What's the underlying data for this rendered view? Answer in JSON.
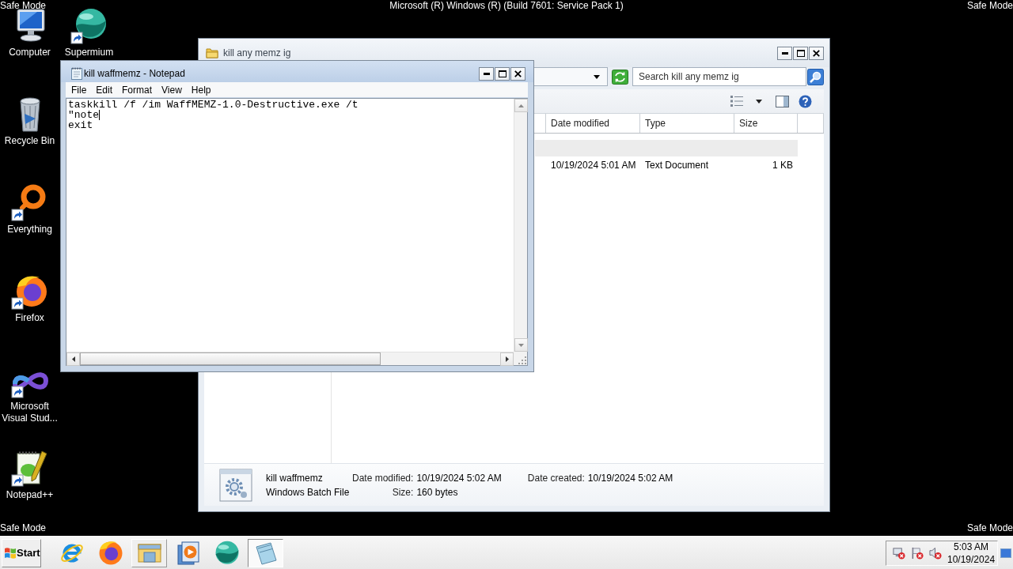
{
  "desktop": {
    "header": {
      "left": "Safe Mode",
      "center": "Microsoft (R) Windows (R) (Build 7601: Service Pack 1)",
      "right": "Safe Mode"
    },
    "icons": [
      {
        "label": "Computer",
        "kind": "computer",
        "shortcut": false
      },
      {
        "label": "Recycle Bin",
        "kind": "bin",
        "shortcut": false
      },
      {
        "label": "Everything",
        "kind": "ring",
        "shortcut": true
      },
      {
        "label": "Firefox",
        "kind": "fox",
        "shortcut": true
      },
      {
        "label": "Microsoft Visual Stud...",
        "kind": "infinity",
        "shortcut": true
      },
      {
        "label": "Notepad++",
        "kind": "notepad",
        "shortcut": true
      },
      {
        "label": "Supermium",
        "kind": "sphere",
        "shortcut": true
      }
    ],
    "footer": {
      "left": "Safe Mode",
      "right": "Safe Mode"
    }
  },
  "explorer": {
    "title": "kill any memz ig",
    "active": false,
    "search": {
      "placeholder": "Search kill any memz ig"
    },
    "columns": [
      {
        "label": "Date modified"
      },
      {
        "label": "Type"
      },
      {
        "label": "Size"
      }
    ],
    "rows": [
      {
        "selected": true
      },
      {
        "selected": false,
        "cells": [
          "10/19/2024 5:01 AM",
          "Text Document",
          "1 KB"
        ]
      }
    ],
    "details": {
      "name": "kill waffmemz",
      "file_type": "Windows Batch File",
      "field_groups": [
        {
          "fields": [
            {
              "label": "Date modified:",
              "value": "10/19/2024 5:02 AM"
            },
            {
              "label": "Size:",
              "value": "160 bytes"
            }
          ]
        },
        {
          "fields": [
            {
              "label": "Date created:",
              "value": "10/19/2024 5:02 AM"
            }
          ]
        }
      ]
    }
  },
  "notepad": {
    "title": "kill waffmemz - Notepad",
    "active": true,
    "menu": [
      "File",
      "Edit",
      "Format",
      "View",
      "Help"
    ],
    "lines": [
      {
        "text": "taskkill /f /im WaffMEMZ-1.0-Destructive.exe /t",
        "caret": false
      },
      {
        "text": "\"note",
        "caret": true
      },
      {
        "text": "exit",
        "caret": false
      }
    ]
  },
  "taskbar": {
    "start": {
      "label": "Start"
    },
    "buttons": [
      {
        "kind": "ie",
        "open": false,
        "selected": false
      },
      {
        "kind": "fox",
        "open": false,
        "selected": false
      },
      {
        "kind": "folder",
        "open": true,
        "selected": false
      },
      {
        "kind": "player",
        "open": false,
        "selected": false
      },
      {
        "kind": "sphere",
        "open": false,
        "selected": false
      },
      {
        "kind": "notepad",
        "open": true,
        "selected": true
      }
    ],
    "tray": {
      "icons": [
        {
          "kind": "network"
        },
        {
          "kind": "flag"
        },
        {
          "kind": "speaker"
        }
      ],
      "time": "5:03 AM",
      "date": "10/19/2024"
    }
  }
}
